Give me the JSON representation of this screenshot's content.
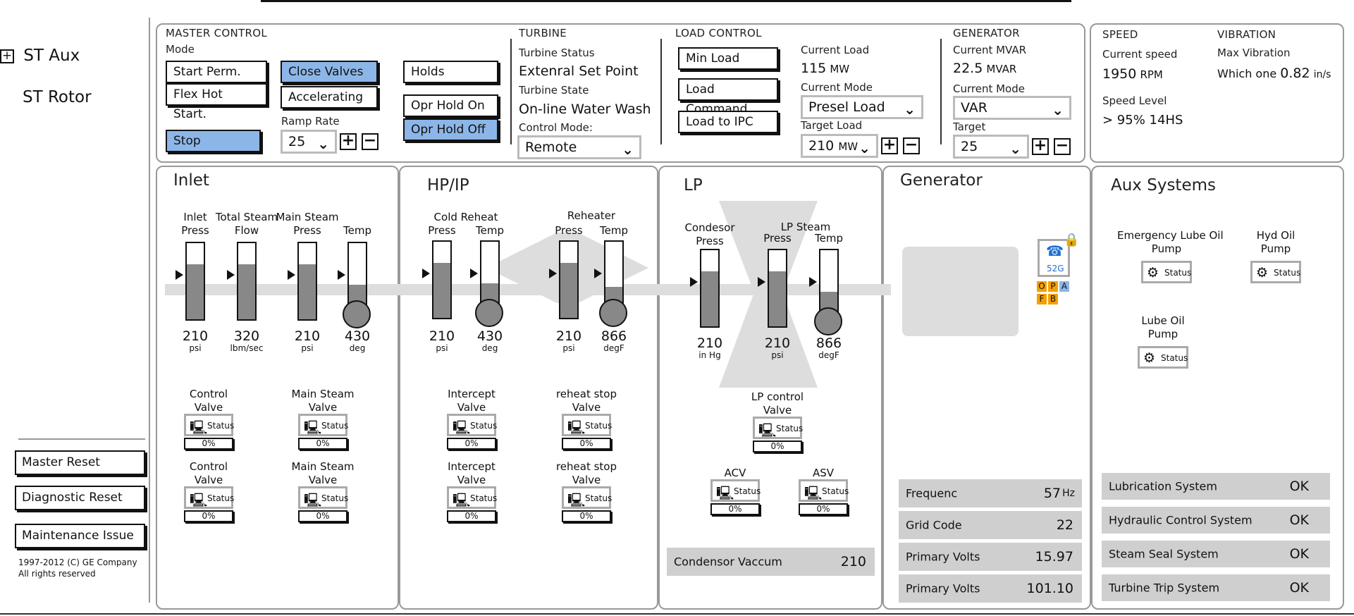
{
  "nav": {
    "st_aux": "ST Aux",
    "expand_icon": "+",
    "st_rotor": "ST Rotor"
  },
  "side_buttons": {
    "master_reset": "Master Reset",
    "diagnostic_reset": "Diagnostic Reset",
    "maintenance_issue": "Maintenance Issue"
  },
  "copyright": {
    "line1": "1997-2012 (C) GE Company",
    "line2": "All rights reserved"
  },
  "master_control": {
    "title": "MASTER CONTROL",
    "mode_label": "Mode",
    "start_perm": "Start Perm.",
    "flex_hot_start": "Flex Hot Start.",
    "stop": "Stop",
    "close_valves": "Close Valves",
    "accelerating": "Accelerating",
    "ramp_rate_label": "Ramp Rate",
    "ramp_rate_value": "25",
    "holds": "Holds",
    "opr_hold_on": "Opr Hold On",
    "opr_hold_off": "Opr Hold Off"
  },
  "turbine": {
    "title": "TURBINE",
    "status_label": "Turbine Status",
    "status_value": "Extenral Set Point",
    "state_label": "Turbine State",
    "state_value": "On-line Water Wash",
    "control_mode_label": "Control Mode:",
    "control_mode_value": "Remote"
  },
  "load_control": {
    "title": "LOAD CONTROL",
    "min_load": "Min Load",
    "load_command": "Load Command",
    "load_to_ipc": "Load to IPC",
    "current_load_label": "Current Load",
    "current_load_value": "115",
    "current_load_unit": "MW",
    "current_mode_label": "Current Mode",
    "current_mode_value": "Presel Load",
    "target_load_label": "Target Load",
    "target_load_value": "210",
    "target_load_unit": "MW"
  },
  "generator_ctrl": {
    "title": "GENERATOR",
    "mvar_label": "Current MVAR",
    "mvar_value": "22.5",
    "mvar_unit": "MVAR",
    "mode_label": "Current Mode",
    "mode_value": "VAR",
    "target_label": "Target",
    "target_value": "25"
  },
  "speed": {
    "title": "SPEED",
    "current_label": "Current speed",
    "current_value": "1950",
    "current_unit": "RPM",
    "level_label": "Speed Level",
    "level_value": "> 95% 14HS"
  },
  "vibration": {
    "title": "VIBRATION",
    "max_label": "Max Vibration",
    "max_value_prefix": "Which one",
    "max_value": "0.82",
    "max_unit": "in/s"
  },
  "icons": {
    "plus": "+",
    "minus": "−",
    "chevron": "⌄",
    "status_icon": "🖳",
    "pump_icon": "⚙",
    "lock_icon": "🔒",
    "phone_icon": "☎"
  },
  "status_text": "Status",
  "inlet": {
    "title": "Inlet",
    "gauges": [
      {
        "label": "Inlet\nPress",
        "value": "210",
        "unit": "psi",
        "level": 0.72
      },
      {
        "label": "Total Steam\nFlow",
        "value": "320",
        "unit": "lbm/sec",
        "level": 0.72
      },
      {
        "label": "Main Steam\nPress",
        "value": "210",
        "unit": "psi",
        "level": 0.72
      },
      {
        "label": "Temp",
        "value": "430",
        "unit": "deg",
        "level": 0.35
      }
    ],
    "valves": [
      {
        "label1": "Control",
        "label2": "Valve",
        "pct": "0%"
      },
      {
        "label1": "Main Steam",
        "label2": "Valve",
        "pct": "0%"
      },
      {
        "label1": "Control",
        "label2": "Valve",
        "pct": "0%"
      },
      {
        "label1": "Main Steam",
        "label2": "Valve",
        "pct": "0%"
      }
    ]
  },
  "hpip": {
    "title": "HP/IP",
    "group1": "Cold Reheat",
    "group2": "Reheater",
    "gauges": [
      {
        "label": "Press",
        "value": "210",
        "unit": "psi",
        "level": 0.72
      },
      {
        "label": "Temp",
        "value": "430",
        "unit": "deg",
        "level": 0.35
      },
      {
        "label": "Press",
        "value": "210",
        "unit": "psi",
        "level": 0.72
      },
      {
        "label": "Temp",
        "value": "866",
        "unit": "degF",
        "level": 0.3
      }
    ],
    "valves": [
      {
        "label1": "Intercept",
        "label2": "Valve",
        "pct": "0%"
      },
      {
        "label1": "reheat stop",
        "label2": "Valve",
        "pct": "0%"
      },
      {
        "label1": "Intercept",
        "label2": "Valve",
        "pct": "0%"
      },
      {
        "label1": "reheat stop",
        "label2": "Valve",
        "pct": "0%"
      }
    ]
  },
  "lp": {
    "title": "LP",
    "group": "LP Steam",
    "gauges": [
      {
        "label": "Condesor\nPress",
        "value": "210",
        "unit": "in Hg",
        "level": 0.72
      },
      {
        "label": "Press",
        "value": "210",
        "unit": "psi",
        "level": 0.72
      },
      {
        "label": "Temp",
        "value": "866",
        "unit": "degF",
        "level": 0.35
      }
    ],
    "valves": [
      {
        "label1": "LP control",
        "label2": "Valve",
        "pct": "0%"
      },
      {
        "label1": "ACV",
        "label2": "",
        "pct": "0%"
      },
      {
        "label1": "ASV",
        "label2": "",
        "pct": "0%"
      }
    ],
    "vacuum_label": "Condensor Vaccum",
    "vacuum_value": "210"
  },
  "generator": {
    "title": "Generator",
    "breaker_label": "52G",
    "flags": [
      "O",
      "P",
      "A",
      "F",
      "B"
    ],
    "rows": [
      {
        "label": "Frequenc",
        "value": "57",
        "unit": "Hz"
      },
      {
        "label": "Grid Code",
        "value": "22",
        "unit": ""
      },
      {
        "label": "Primary Volts",
        "value": "15.97",
        "unit": ""
      },
      {
        "label": "Primary Volts",
        "value": "101.10",
        "unit": ""
      }
    ]
  },
  "aux": {
    "title": "Aux Systems",
    "pumps": [
      {
        "label": "Emergency Lube Oil\nPump"
      },
      {
        "label": "Hyd Oil\nPump"
      },
      {
        "label": "Lube Oil\nPump"
      }
    ],
    "systems": [
      {
        "label": "Lubrication System",
        "status": "OK"
      },
      {
        "label": "Hydraulic Control System",
        "status": "OK"
      },
      {
        "label": "Steam Seal System",
        "status": "OK"
      },
      {
        "label": "Turbine Trip System",
        "status": "OK"
      }
    ]
  },
  "colors": {
    "accent": "#8db6e8",
    "flag_orange": "#f5a000",
    "flag_blue": "#8db6e8",
    "breaker_blue": "#1e6fd0"
  }
}
